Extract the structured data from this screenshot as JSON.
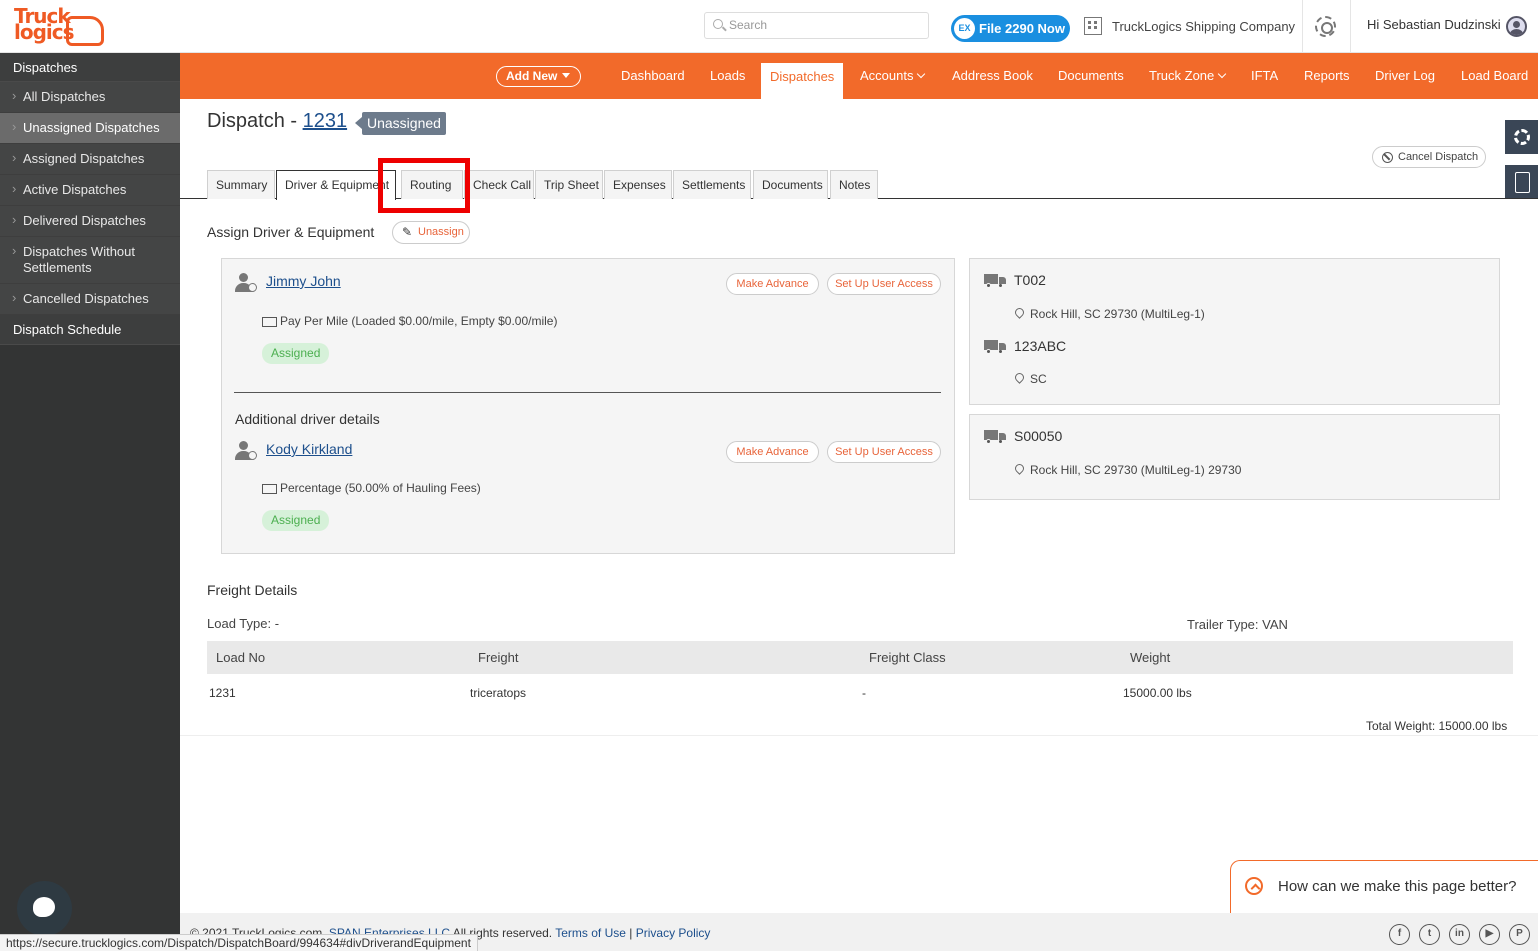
{
  "header": {
    "logo_line1": "Truck",
    "logo_line2": "logics",
    "search_placeholder": "Search",
    "file2290_badge": "EX",
    "file2290_label": "File 2290 Now",
    "company": "TruckLogics Shipping Company",
    "greeting": "Hi Sebastian Dudzinski"
  },
  "sidebar": {
    "heading": "Dispatches",
    "items": [
      {
        "label": "All Dispatches"
      },
      {
        "label": "Unassigned Dispatches"
      },
      {
        "label": "Assigned Dispatches"
      },
      {
        "label": "Active Dispatches"
      },
      {
        "label": "Delivered Dispatches"
      },
      {
        "label": "Dispatches Without Settlements"
      },
      {
        "label": "Cancelled Dispatches"
      }
    ],
    "active_index": 1,
    "schedule": "Dispatch Schedule"
  },
  "nav": {
    "add_new": "Add New",
    "items": [
      "Dashboard",
      "Loads",
      "Dispatches",
      "Accounts",
      "Address Book",
      "Documents",
      "Truck Zone",
      "IFTA",
      "Reports",
      "Driver Log",
      "Load Board"
    ],
    "active": "Dispatches"
  },
  "dispatch": {
    "title_prefix": "Dispatch - ",
    "number": "1231",
    "status": "Unassigned",
    "cancel_label": "Cancel Dispatch"
  },
  "tabs": [
    "Summary",
    "Driver & Equipment",
    "Routing",
    "Check Call",
    "Trip Sheet",
    "Expenses",
    "Settlements",
    "Documents",
    "Notes"
  ],
  "assign": {
    "heading": "Assign Driver & Equipment",
    "unassign_label": "Unassign"
  },
  "drivers": [
    {
      "name": "Jimmy John",
      "pay": "Pay Per Mile (Loaded $0.00/mile, Empty $0.00/mile)",
      "status": "Assigned",
      "advance_label": "Make Advance",
      "access_label": "Set Up User Access"
    },
    {
      "name": "Kody Kirkland",
      "pay": "Percentage (50.00% of Hauling Fees)",
      "status": "Assigned",
      "advance_label": "Make Advance",
      "access_label": "Set Up User Access"
    }
  ],
  "additional_heading": "Additional driver details",
  "equipment": {
    "truck1": {
      "name": "T002",
      "location": "Rock Hill, SC 29730 (MultiLeg-1)"
    },
    "truck2": {
      "name": "123ABC",
      "location": "SC"
    },
    "trailer": {
      "name": "S00050",
      "location": "Rock Hill, SC 29730 (MultiLeg-1) 29730"
    }
  },
  "freight": {
    "heading": "Freight Details",
    "load_type": "Load Type: -",
    "trailer_type": "Trailer Type: VAN",
    "columns": [
      "Load No",
      "Freight",
      "Freight Class",
      "Weight"
    ],
    "rows": [
      [
        "1231",
        "triceratops",
        "-",
        "15000.00 lbs"
      ]
    ],
    "total_weight": "Total Weight:  15000.00 lbs"
  },
  "feedback": "How can we make this page better?",
  "footer": {
    "copyright": "© 2021 TruckLogics.com, ",
    "company_link": "SPAN Enterprises LLC",
    "rights": " All rights reserved. ",
    "terms": "Terms of Use",
    "pipe": " | ",
    "privacy": "Privacy Policy",
    "social": [
      "f",
      "t",
      "in",
      "▶",
      "P"
    ]
  },
  "statusbar_url": "https://secure.trucklogics.com/Dispatch/DispatchBoard/994634#divDriverandEquipment",
  "colors": {
    "brand_orange": "#f26a2a",
    "sidebar_bg": "#333434",
    "link_blue": "#1d4f8c",
    "highlight_red": "#e00000"
  }
}
